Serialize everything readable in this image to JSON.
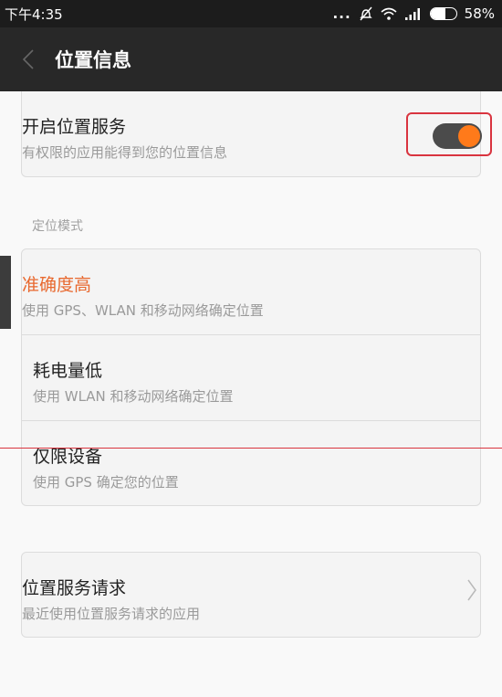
{
  "status_bar": {
    "time": "下午4:35",
    "dots": "...",
    "battery_percent": "58%",
    "battery_level": 0.58,
    "icons": [
      "mute-icon",
      "wifi-icon",
      "signal-icon",
      "battery-icon"
    ]
  },
  "app_bar": {
    "back_icon": "chevron-left-icon",
    "title": "位置信息"
  },
  "location_service": {
    "title": "开启位置服务",
    "subtitle": "有权限的应用能得到您的位置信息",
    "toggle_on": true,
    "toggle_color": "#ff7a1a"
  },
  "mode_section": {
    "label": "定位模式",
    "options": [
      {
        "title": "准确度高",
        "subtitle": "使用 GPS、WLAN 和移动网络确定位置",
        "selected": true
      },
      {
        "title": "耗电量低",
        "subtitle": "使用 WLAN 和移动网络确定位置",
        "selected": false
      },
      {
        "title": "仅限设备",
        "subtitle": "使用 GPS 确定您的位置",
        "selected": false
      }
    ]
  },
  "requests": {
    "title": "位置服务请求",
    "subtitle": "最近使用位置服务请求的应用",
    "chevron_icon": "chevron-right-icon"
  },
  "colors": {
    "accent": "#e8682e",
    "highlight_box": "#d9343f",
    "app_bar": "#282828"
  }
}
